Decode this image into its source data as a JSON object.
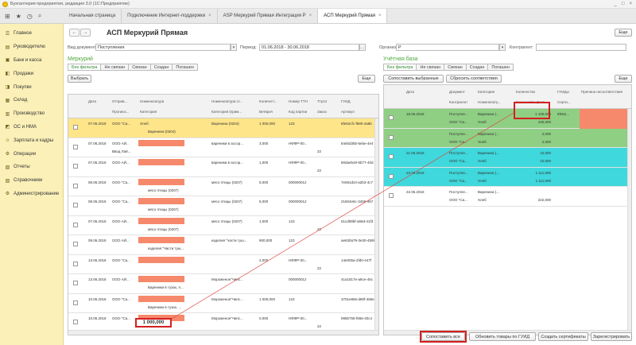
{
  "window": {
    "title": "Бухгалтерия предприятия, редакция 3.0 (1С:Предприятие)",
    "controls": [
      "_",
      "□",
      "×"
    ]
  },
  "tabs": [
    {
      "label": "Начальная страница",
      "active": false,
      "closable": false
    },
    {
      "label": "Подключение Интернет-поддержки",
      "active": false,
      "closable": true
    },
    {
      "label": "ASP Меркурий Прямая Интеграция Р",
      "active": false,
      "closable": true
    },
    {
      "label": "АСП Меркурий Прямая",
      "active": true,
      "closable": true
    }
  ],
  "toolbar_icons": [
    "grid-icon",
    "star-icon",
    "history-icon",
    "search-icon"
  ],
  "sidebar": {
    "items": [
      {
        "label": "Главное",
        "icon": "menu-icon"
      },
      {
        "label": "Руководителю",
        "icon": "chart-icon"
      },
      {
        "label": "Банк и касса",
        "icon": "bank-icon"
      },
      {
        "label": "Продажи",
        "icon": "sales-icon"
      },
      {
        "label": "Покупки",
        "icon": "cart-icon"
      },
      {
        "label": "Склад",
        "icon": "warehouse-icon"
      },
      {
        "label": "Производство",
        "icon": "factory-icon"
      },
      {
        "label": "ОС и НМА",
        "icon": "assets-icon"
      },
      {
        "label": "Зарплата и кадры",
        "icon": "people-icon"
      },
      {
        "label": "Операции",
        "icon": "operations-icon"
      },
      {
        "label": "Отчеты",
        "icon": "reports-icon"
      },
      {
        "label": "Справочники",
        "icon": "book-icon"
      },
      {
        "label": "Администрирование",
        "icon": "gear-icon"
      }
    ]
  },
  "form": {
    "back": "←",
    "forward": "→",
    "title": "АСП Меркурий Прямая",
    "more": "Еще",
    "doc_type_label": "Вид документа",
    "doc_type_value": "Поступления",
    "period_label": "Период:",
    "period_value": "01.06.2018 - 30.06.2018",
    "period_btn": "...",
    "org_label": "Организация:",
    "org_value": "Р",
    "counterparty_label": "Контрагент:",
    "counterparty_value": ""
  },
  "left": {
    "title": "Меркурий",
    "filters": [
      "Без фильтра",
      "Не связан",
      "Связан",
      "Создан",
      "Погашен"
    ],
    "select_button": "Выбрать",
    "more": "Еще",
    "headers1": [
      "Дата",
      "Отправ...",
      "Номенклатура",
      "Номенклатура ст...",
      "Количест...",
      "Номер ТТН",
      "Ттр12",
      "ГУИД"
    ],
    "headers2": [
      "Прописк...",
      "Категория",
      "Категория (прим...",
      "Ветврач",
      "Код партии",
      "Заказ",
      "Артикул"
    ],
    "rows": [
      {
        "date": "07.06.2018",
        "sender": "ООО \"Са...",
        "nom": "Хлеб",
        "nom2": "Варенина (0204)",
        "nomst": "Варенина (0204)",
        "qty": "1 000,000",
        "ttn": "123",
        "guid": "5fe52cfc-f680-4a6b",
        "highlight": true
      },
      {
        "date": "07.06.2018",
        "sender": "ООО АЙ...",
        "nom": "",
        "nom2": "",
        "nomst": "вареники в ассор...",
        "qty": "3,000",
        "ttn": "НФФР-00...",
        "guid": "84ebd35b-5ebe-4e4",
        "sub": "Ввод Лай...",
        "order": "22"
      },
      {
        "date": "07.06.2018",
        "sender": "ООО АЙ...",
        "nom": "",
        "nom2": "",
        "nomst": "вареники в ассор...",
        "qty": "1,000",
        "ttn": "НФФР-00...",
        "guid": "80daeb49-5b77-40d",
        "order": "22"
      },
      {
        "date": "08.06.2018",
        "sender": "ООО \"Са...",
        "nom": "",
        "nom2": "мясо птицы (0207)",
        "nomst": "мясо птицы (0207)",
        "qty": "5,000",
        "ttn": "000000012",
        "guid": "7e591dc0-a2b3-4c7"
      },
      {
        "date": "08.06.2018",
        "sender": "ООО \"Са...",
        "nom": "",
        "nom2": "мясо птицы (0207)",
        "nomst": "мясо птицы (0207)",
        "qty": "5,000",
        "ttn": "000000012",
        "guid": "21604e6c-3406-467"
      },
      {
        "date": "07.06.2018",
        "sender": "ООО АЙ...",
        "nom": "",
        "nom2": "мясо птицы (0207)",
        "nomst": "мясо птицы (0207)",
        "qty": "1,000",
        "ttn": "123",
        "guid": "51cd08bf-a66d-41f3",
        "order": "22"
      },
      {
        "date": "09.06.2018",
        "sender": "ООО АЙ...",
        "nom": "",
        "nom2": "изделия \"Части туш...",
        "nomst": "изделия \"части туш...",
        "qty": "900,000",
        "ttn": "123",
        "guid": "ae630a79-3e30-4599"
      },
      {
        "date": "13.06.2018",
        "sender": "ООО \"Са...",
        "nom": "",
        "nom2": "",
        "nomst": "",
        "qty": "2,000",
        "ttn": "НФФР-00...",
        "guid": "14e005a-2fd0-447f",
        "order": "22"
      },
      {
        "date": "13.06.2018",
        "sender": "ООО АЙ...",
        "nom": "",
        "nom2": "Вареники в тузах, п...",
        "nomst": "Мороженое\"Чипс...",
        "qty": "",
        "ttn": "000000012",
        "guid": "41a1817e-a8ce-45c"
      },
      {
        "date": "10.06.2018",
        "sender": "ООО \"Са...",
        "nom": "",
        "nom2": "Вареники в тузах, ...",
        "nomst": "Мороженое\"Чипс...",
        "qty": "1 000,000",
        "ttn": "123",
        "guid": "3701e856-d80f-465e"
      },
      {
        "date": "10.06.2018",
        "sender": "ООО \"Са...",
        "nom": "",
        "nom2": "",
        "nomst": "Мороженое\"Чипс...",
        "qty": "0,000",
        "ttn": "НФФР-00...",
        "guid": "995b755-f666-40c4",
        "order": "22"
      }
    ],
    "sum": "1 000,000"
  },
  "right": {
    "title": "Учётная база",
    "filters": [
      "Без фильтра",
      "Не связан",
      "Связан",
      "Создан",
      "Погашен"
    ],
    "match_selected": "Сопоставить выбранные",
    "reset_match": "Сбросить соответствия",
    "more": "Еще",
    "headers1": [
      "Дата",
      "Документ",
      "Категория",
      "Количество",
      "ГУИДы",
      "Причина несоответствия"
    ],
    "headers2": [
      "Контрагент",
      "Номенклату...",
      "Количество факт",
      "Серти..."
    ],
    "rows": [
      {
        "date": "18.06.2018",
        "doc": "Поступле...",
        "cat": "Варенина (...",
        "qty": "1 100,000",
        "guid": "5fe52...",
        "cp": "ООО \"Са...",
        "nom": "Хлеб",
        "qtyf": "100,000",
        "color": "#8fcf84",
        "reason": true
      },
      {
        "date": "",
        "doc": "Поступле...",
        "cat": "Варенина (...",
        "qty": "2,000",
        "guid": "",
        "cp": "ООО \"Са...",
        "nom": "Хлеб",
        "qtyf": "2,000",
        "color": "#8fcf84"
      },
      {
        "date": "21.06.2018",
        "doc": "Поступле...",
        "cat": "Варенина (...",
        "qty": "10,000",
        "guid": "",
        "cp": "ООО \"Са...",
        "nom": "Хлеб",
        "qtyf": "10,000",
        "color": "#3fd8dc"
      },
      {
        "date": "22.06.2018",
        "doc": "Поступле...",
        "cat": "Варенина (...",
        "qty": "1 111,000",
        "guid": "",
        "cp": "ООО \"Са...",
        "nom": "Хлеб",
        "qtyf": "1 111,000",
        "color": "#3fd8dc"
      },
      {
        "date": "22.06.2018",
        "doc": "Поступле...",
        "cat": "Варенина (...",
        "qty": "",
        "guid": "",
        "cp": "ООО \"Са...",
        "nom": "Хлеб",
        "qtyf": "222,000",
        "color": "#ffffff"
      }
    ]
  },
  "bottom": {
    "match_all": "Сопоставить все",
    "update_goods": "Обновить товары по ГУИД",
    "create_certs": "Создать сертификаты",
    "register": "Зарегистрировать"
  },
  "colors": {
    "sidebar": "#fbf0b8",
    "accent_green": "#4caa3a",
    "highlight_row": "#ffe58a",
    "salmon": "#f6896b",
    "match_green": "#8fcf84",
    "match_cyan": "#3fd8dc",
    "annotation_red": "#d41f1f"
  }
}
